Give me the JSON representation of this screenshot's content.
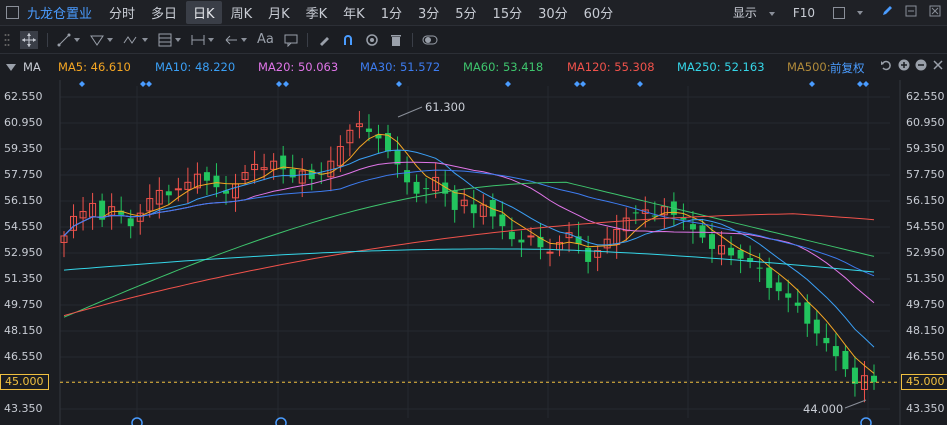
{
  "topbar": {
    "stock_name": "九龙仓置业",
    "periods": [
      "分时",
      "多日",
      "日K",
      "周K",
      "月K",
      "季K",
      "年K",
      "1分",
      "3分",
      "5分",
      "15分",
      "30分",
      "60分"
    ],
    "active_period": "日K",
    "display_label": "显示",
    "f10_label": "F10"
  },
  "toolbar": {
    "text_tool": "Aa"
  },
  "ma_bar": {
    "indicator": "MA",
    "items": [
      {
        "label": "MA5: 46.610",
        "color": "#f5a623"
      },
      {
        "label": "MA10: 48.220",
        "color": "#3a9ff5"
      },
      {
        "label": "MA20: 50.063",
        "color": "#e075e8"
      },
      {
        "label": "MA30: 51.572",
        "color": "#3d7cf0"
      },
      {
        "label": "MA60: 53.418",
        "color": "#3ec46d"
      },
      {
        "label": "MA120: 55.308",
        "color": "#f0524b"
      },
      {
        "label": "MA250: 52.163",
        "color": "#35d6e8"
      },
      {
        "label": "MA500:",
        "color": "#b08a3a"
      }
    ],
    "adjust_label": "前复权"
  },
  "axis": {
    "ticks": [
      "62.550",
      "60.950",
      "59.350",
      "57.750",
      "56.150",
      "54.550",
      "52.950",
      "51.350",
      "49.750",
      "48.150",
      "46.550",
      "45.000",
      "43.350"
    ],
    "current_price": "45.000"
  },
  "annotations": {
    "high": "61.300",
    "low": "44.000"
  },
  "colors": {
    "up": "#f0524b",
    "down": "#22c55e",
    "accent": "#4a9cff"
  },
  "chart_data": {
    "type": "candlestick",
    "ylim": [
      43.35,
      62.55
    ],
    "high_marker": 61.3,
    "low_marker": 44.0,
    "current_price": 45.0
  }
}
